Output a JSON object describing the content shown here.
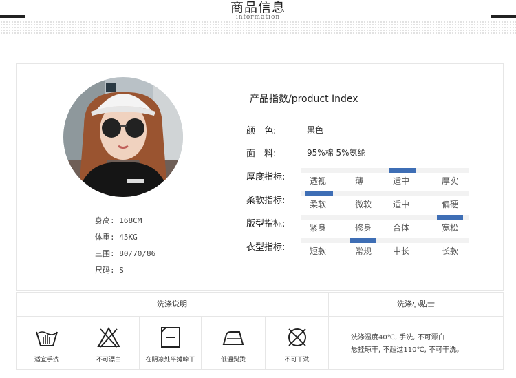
{
  "header": {
    "title": "商品信息",
    "subtitle": "— information —"
  },
  "model": {
    "stats": [
      "身高: 168CM",
      "体重: 45KG",
      "三围: 80/70/86",
      "尺码: S"
    ]
  },
  "product": {
    "title": "产品指数/product Index",
    "color_label": "颜　色:",
    "color_value": "黑色",
    "fabric_label": "面　料:",
    "fabric_value": "95%棉 5%氨纶",
    "indices": [
      {
        "label": "厚度指标:",
        "options": [
          "透视",
          "薄",
          "适中",
          "厚实"
        ],
        "selected": 2
      },
      {
        "label": "柔软指标:",
        "options": [
          "柔软",
          "微软",
          "适中",
          "偏硬"
        ],
        "selected": 0
      },
      {
        "label": "版型指标:",
        "options": [
          "紧身",
          "修身",
          "合体",
          "宽松"
        ],
        "selected": 3
      },
      {
        "label": "衣型指标:",
        "options": [
          "短款",
          "常规",
          "中长",
          "长款"
        ],
        "selected": 1
      }
    ]
  },
  "care": {
    "title": "洗涤说明",
    "tips_title": "洗涤小贴士",
    "items": [
      {
        "label": "适宜手洗",
        "icon": "hand-wash-icon"
      },
      {
        "label": "不可漂白",
        "icon": "no-bleach-icon"
      },
      {
        "label": "在阴凉处平摊晾干",
        "icon": "dry-flat-shade-icon"
      },
      {
        "label": "低温熨烫",
        "icon": "low-iron-icon"
      },
      {
        "label": "不可干洗",
        "icon": "no-dry-clean-icon"
      }
    ],
    "tips": [
      "洗涤温度40℃, 手洗, 不可漂白",
      "悬挂晾干, 不超过110℃, 不可干洗。"
    ]
  },
  "colors": {
    "accent": "#3e6eb5",
    "track": "#f2f2f2",
    "border": "#e6e6e6"
  }
}
